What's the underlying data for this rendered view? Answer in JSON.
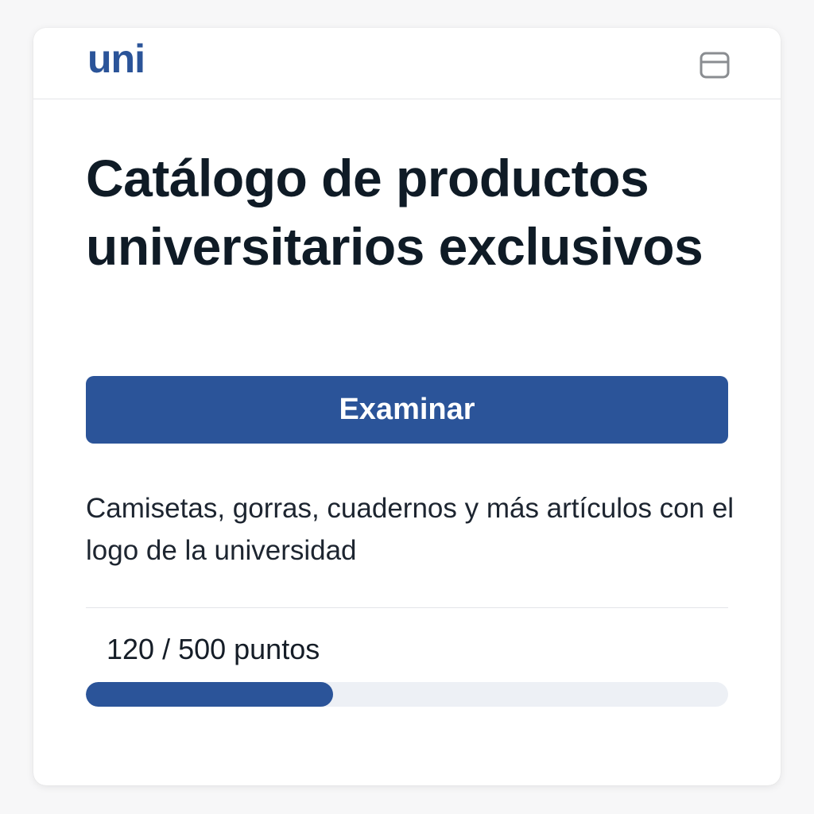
{
  "header": {
    "logo_text": "uni",
    "window_icon": "window-icon"
  },
  "main": {
    "title": "Catálogo de productos universitarios exclusivos",
    "button_label": "Examinar",
    "description": "Camisetas, gorras, cuadernos y más artículos con el logo de la universidad"
  },
  "progress": {
    "label": "120 / 500 puntos",
    "current": 120,
    "total": 500,
    "fill_fraction": 0.385
  },
  "colors": {
    "accent": "#2b5499",
    "track": "#edf0f5",
    "title_text": "#0f1b26",
    "background": "#f7f7f8"
  }
}
